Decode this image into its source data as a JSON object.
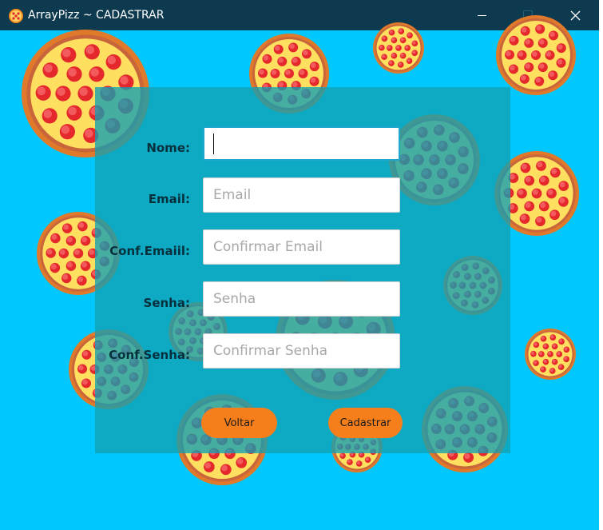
{
  "window": {
    "title": "ArrayPizz ~ CADASTRAR",
    "icon": "pizza-icon",
    "controls": {
      "minimize": "minimize-icon",
      "maximize": "maximize-icon",
      "close": "close-icon"
    }
  },
  "colors": {
    "background": "#00c8ff",
    "titlebar": "#0e3a4f",
    "panel": "#12a0b2",
    "button": "#f67f1c"
  },
  "form": {
    "fields": [
      {
        "label": "Nome:",
        "placeholder": "",
        "value": ""
      },
      {
        "label": "Email:",
        "placeholder": "Email",
        "value": ""
      },
      {
        "label": "Conf.Emaiil:",
        "placeholder": "Confirmar Email",
        "value": ""
      },
      {
        "label": "Senha:",
        "placeholder": "Senha",
        "value": ""
      },
      {
        "label": "Conf.Senha:",
        "placeholder": "Confirmar Senha",
        "value": ""
      }
    ],
    "buttons": {
      "back": "Voltar",
      "submit": "Cadastrar"
    }
  }
}
